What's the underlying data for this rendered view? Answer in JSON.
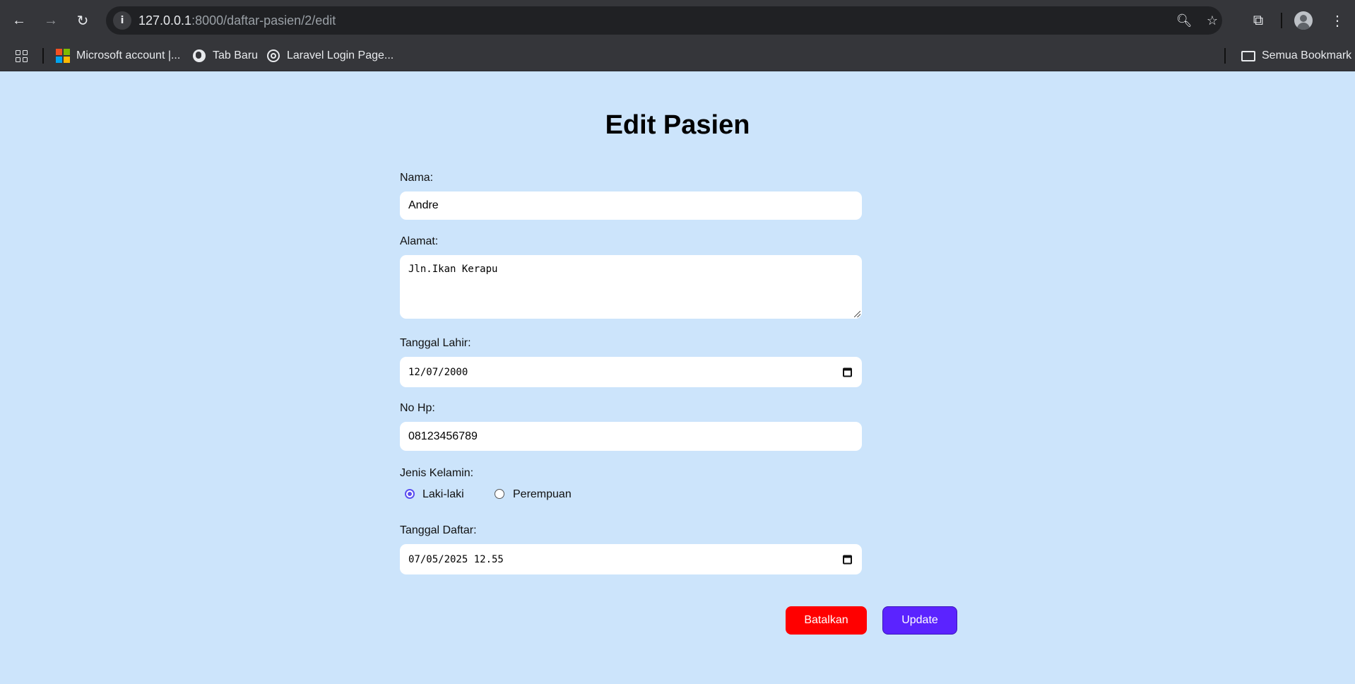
{
  "browser": {
    "url_host": "127.0.0.1",
    "url_path": ":8000/daftar-pasien/2/edit",
    "info_icon": "info-icon",
    "bookmarks": [
      {
        "label": "Microsoft account |...",
        "icon": "microsoft-icon"
      },
      {
        "label": "Tab Baru",
        "icon": "globe-icon"
      },
      {
        "label": "Laravel Login Page...",
        "icon": "openai-icon"
      }
    ],
    "all_bookmarks_label": "Semua Bookmark"
  },
  "form": {
    "title": "Edit Pasien",
    "nama_label": "Nama:",
    "nama_value": "Andre",
    "alamat_label": "Alamat:",
    "alamat_value": "Jln.Ikan Kerapu",
    "tanggal_lahir_label": "Tanggal Lahir:",
    "tanggal_lahir_value": "12/07/2000",
    "no_hp_label": "No Hp:",
    "no_hp_value": "08123456789",
    "jenis_kelamin_label": "Jenis Kelamin:",
    "gender_options": [
      {
        "label": "Laki-laki",
        "checked": true
      },
      {
        "label": "Perempuan",
        "checked": false
      }
    ],
    "tanggal_daftar_label": "Tanggal Daftar:",
    "tanggal_daftar_value": "07/05/2025 12.55",
    "cancel_label": "Batalkan",
    "update_label": "Update"
  },
  "colors": {
    "page_background": "#cce4fb",
    "cancel_button": "#ff0000",
    "update_button": "#5b23ff",
    "radio_accent": "#5b4ef0"
  }
}
